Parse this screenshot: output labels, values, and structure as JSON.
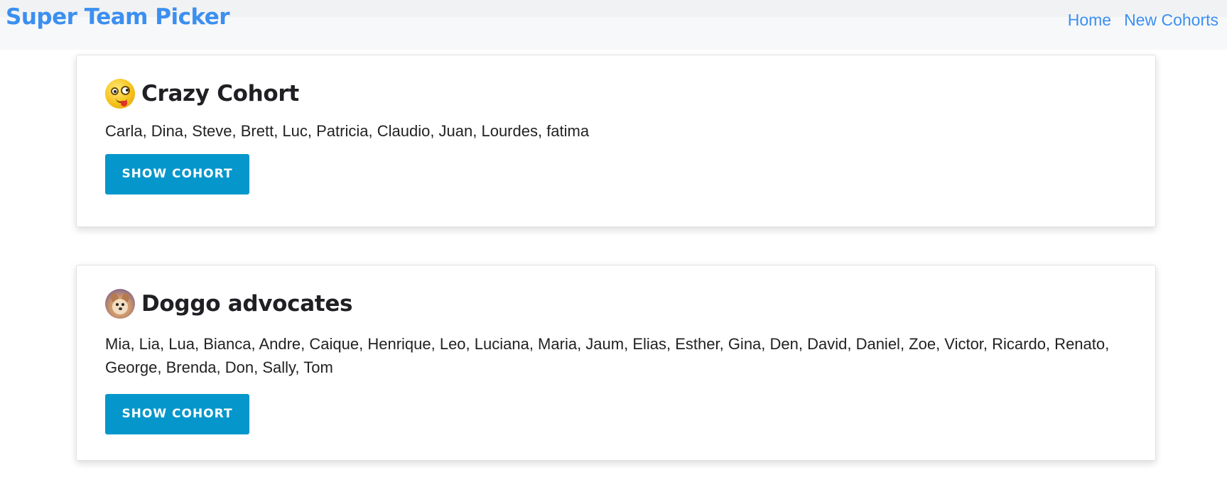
{
  "navbar": {
    "brand": "Super Team Picker",
    "links": [
      {
        "label": "Home"
      },
      {
        "label": "New Cohorts"
      }
    ]
  },
  "cohorts": [
    {
      "name": "Crazy Cohort",
      "avatar_icon": "crazy-face-emoji",
      "members": "Carla, Dina, Steve, Brett, Luc, Patricia, Claudio, Juan, Lourdes, fatima",
      "button_label": "SHOW COHORT"
    },
    {
      "name": "Doggo advocates",
      "avatar_icon": "dog-photo",
      "members": "Mia, Lia, Lua, Bianca, Andre, Caique, Henrique, Leo, Luciana, Maria, Jaum, Elias, Esther, Gina, Den, David, Daniel, Zoe, Victor, Ricardo, Renato, George, Brenda, Don, Sally, Tom",
      "button_label": "SHOW COHORT"
    }
  ],
  "colors": {
    "accent": "#3b8ff0",
    "button": "#0597cb",
    "navbar_bg": "#f7f8f9"
  }
}
